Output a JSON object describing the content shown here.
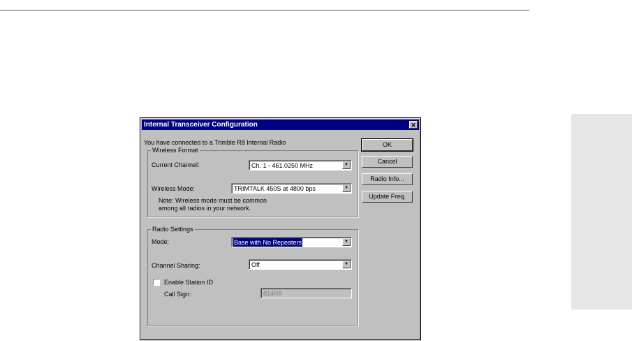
{
  "dialog": {
    "title": "Internal Transceiver Configuration",
    "close_symbol": "✕",
    "intro": "You have connected to a Trimble R8 Internal Radio"
  },
  "wireless_format": {
    "group_label": "Wireless Format",
    "current_channel_label": "Current Channel:",
    "current_channel_value": "Ch.  1 - 461.0250 MHz",
    "wireless_mode_label": "Wireless Mode:",
    "wireless_mode_value": "TRIMTALK 450S at 4800 bps",
    "note_line1": "Note: Wireless mode must be common",
    "note_line2": "among all radios in your network."
  },
  "radio_settings": {
    "group_label": "Radio Settings",
    "mode_label": "Mode:",
    "mode_value": "Base with No Repeaters",
    "channel_sharing_label": "Channel Sharing:",
    "channel_sharing_value": "Off",
    "enable_station_id_label": "Enable Station ID",
    "enable_station_id_checked": false,
    "call_sign_label": "Call Sign:",
    "call_sign_value": "814R8"
  },
  "buttons": {
    "ok": "OK",
    "cancel": "Cancel",
    "radio_info": "Radio Info...",
    "update_freq": "Update Freq."
  },
  "colors": {
    "titlebar": "#000080",
    "dialog_face": "#c0c0c0",
    "selection": "#000080"
  }
}
